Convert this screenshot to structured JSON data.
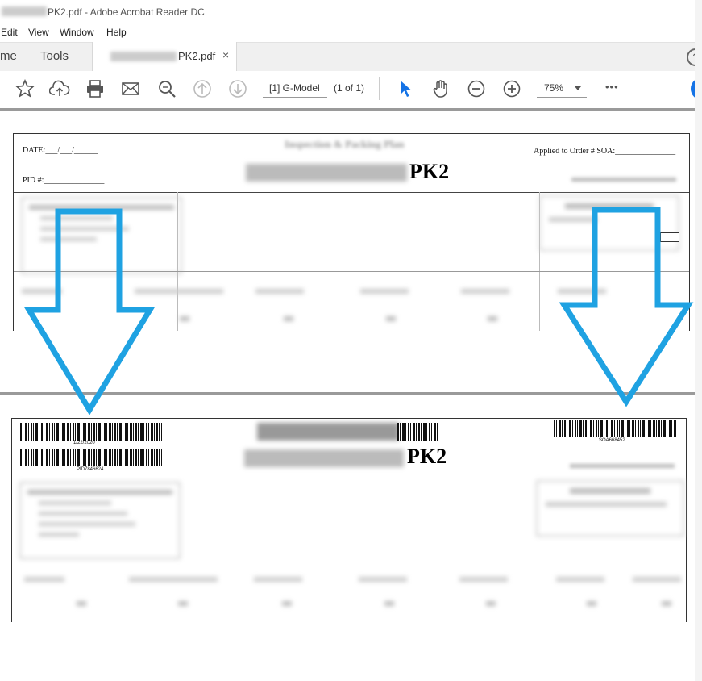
{
  "window": {
    "title_suffix": "PK2.pdf - Adobe Acrobat Reader DC"
  },
  "menu": [
    "Edit",
    "View",
    "Window",
    "Help"
  ],
  "tabs": {
    "home_fragment": "me",
    "tools": "Tools",
    "doc_tab_label": "PK2.pdf",
    "close_glyph": "×"
  },
  "toolbar": {
    "page_label": "[1] G-Model",
    "page_count": "(1 of 1)",
    "zoom": "75%",
    "more": "•••",
    "icons": [
      "star-icon",
      "cloud-upload-icon",
      "printer-icon",
      "mail-icon",
      "zoom-search-icon",
      "page-up-icon",
      "page-down-icon",
      "select-cursor-icon",
      "hand-icon",
      "zoom-out-icon",
      "zoom-in-icon"
    ]
  },
  "help_glyph": "?",
  "doc_top": {
    "date_label": "DATE:___/___/______",
    "pid_label": "PID #:_______________",
    "heading": "Inspection & Packing Plan",
    "title_suffix": "PK2",
    "applied_label": "Applied to Order # SOA:_______________"
  },
  "doc_bottom": {
    "barcode_date": "1/22/2020",
    "barcode_pid": "PID7846624",
    "barcode_soa": "SOA668452",
    "title_suffix": "PK2"
  },
  "colors": {
    "arrow": "#1fa2e2",
    "accent": "#1473e6"
  }
}
